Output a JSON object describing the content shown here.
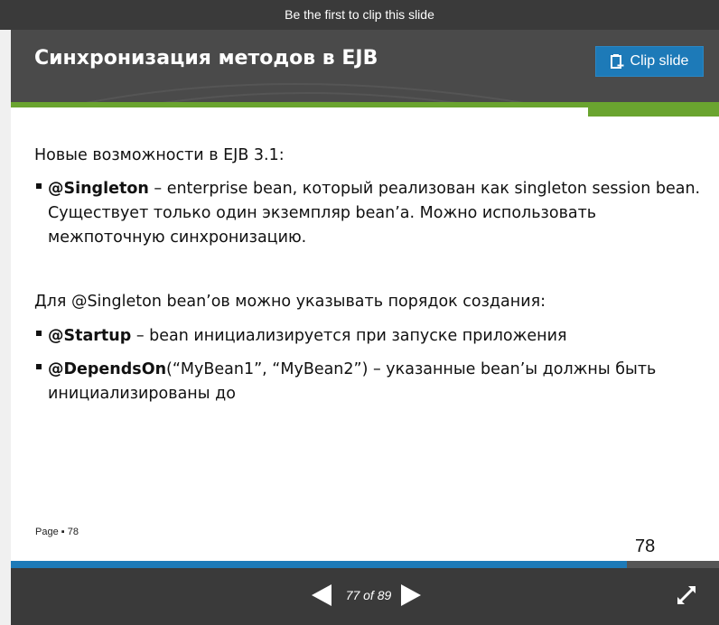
{
  "top_bar": {
    "text": "Be the first to clip this slide"
  },
  "slide": {
    "title": "Синхронизация методов в EJB",
    "clip_button": {
      "label": "Clip slide",
      "icon": "clip-icon"
    },
    "intro1": "Новые возможности в EJB 3.1:",
    "bullet1": {
      "bold": "@Singleton",
      "text": " – enterprise bean, который реализован как singleton session bean. Существует только один экземпляр bean’a. Можно использовать межпоточную синхронизацию."
    },
    "intro2": "Для @Singleton bean’ов можно указывать порядок создания:",
    "bullet2": {
      "bold": "@Startup",
      "text": " – bean инициализируется при запуске приложения"
    },
    "bullet3": {
      "bold": "@DependsOn",
      "text": "(“MyBean1”, “MyBean2”) – указанные bean’ы должны быть инициализированы до"
    },
    "page_label": "Page ▪ 78",
    "slide_number": "78"
  },
  "navigation": {
    "counter": "77 of 89",
    "current": 77,
    "total": 89,
    "progress_percent": 87
  },
  "colors": {
    "accent": "#1d7ab8",
    "green": "#6aa42f",
    "dark": "#3a3a3a"
  }
}
